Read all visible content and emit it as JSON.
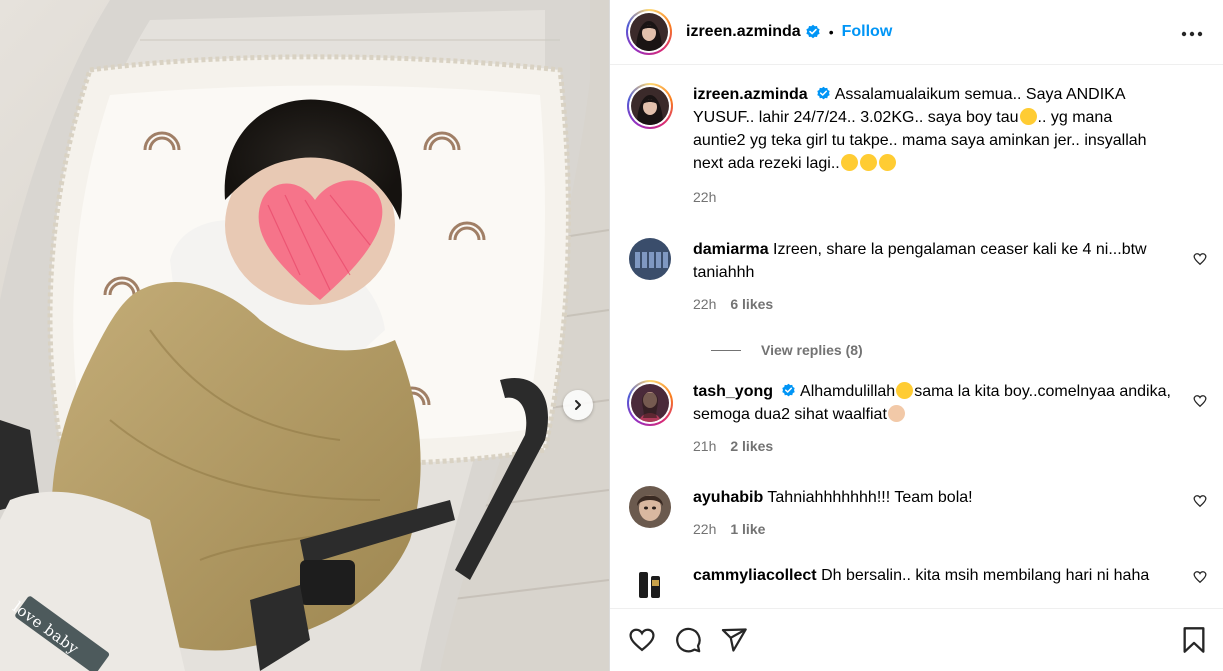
{
  "post": {
    "author": "izreen.azminda",
    "follow_label": "Follow",
    "separator": "•",
    "caption": "Assalamualaikum semua.. Saya ANDIKA YUSUF.. lahir 24/7/24.. 3.02KG.. saya boy tau",
    "caption_part2": ".. yg mana auntie2 yg teka girl tu takpe.. mama saya aminkan jer.. insyallah next ada rezeki lagi..",
    "time": "22h"
  },
  "media": {
    "watermark": "love baby"
  },
  "comments": [
    {
      "user": "damiarma",
      "text": "Izreen, share la pengalaman ceaser kali ke 4 ni...btw taniahhh",
      "time": "22h",
      "likes": "6 likes"
    },
    {
      "user": "tash_yong",
      "verified": true,
      "text_a": "Alhamdulillah",
      "text_b": "sama la kita boy..comelnyaa andika, semoga dua2 sihat waalfiat",
      "time": "21h",
      "likes": "2 likes"
    },
    {
      "user": "ayuhabib",
      "text": "Tahniahhhhhhh!!! Team bola!",
      "time": "22h",
      "likes": "1 like"
    },
    {
      "user": "cammyliacollect",
      "text": "Dh bersalin.. kita msih membilang hari ni haha",
      "time": "",
      "likes": ""
    }
  ],
  "view_replies": "View replies (8)",
  "icons": [
    "heart-icon",
    "comment-icon",
    "share-icon",
    "bookmark-icon",
    "more-icon",
    "verified-icon",
    "chevron-right-icon"
  ],
  "colors": {
    "link": "#0095f6",
    "meta": "#737373",
    "border": "#dbdbdb"
  }
}
